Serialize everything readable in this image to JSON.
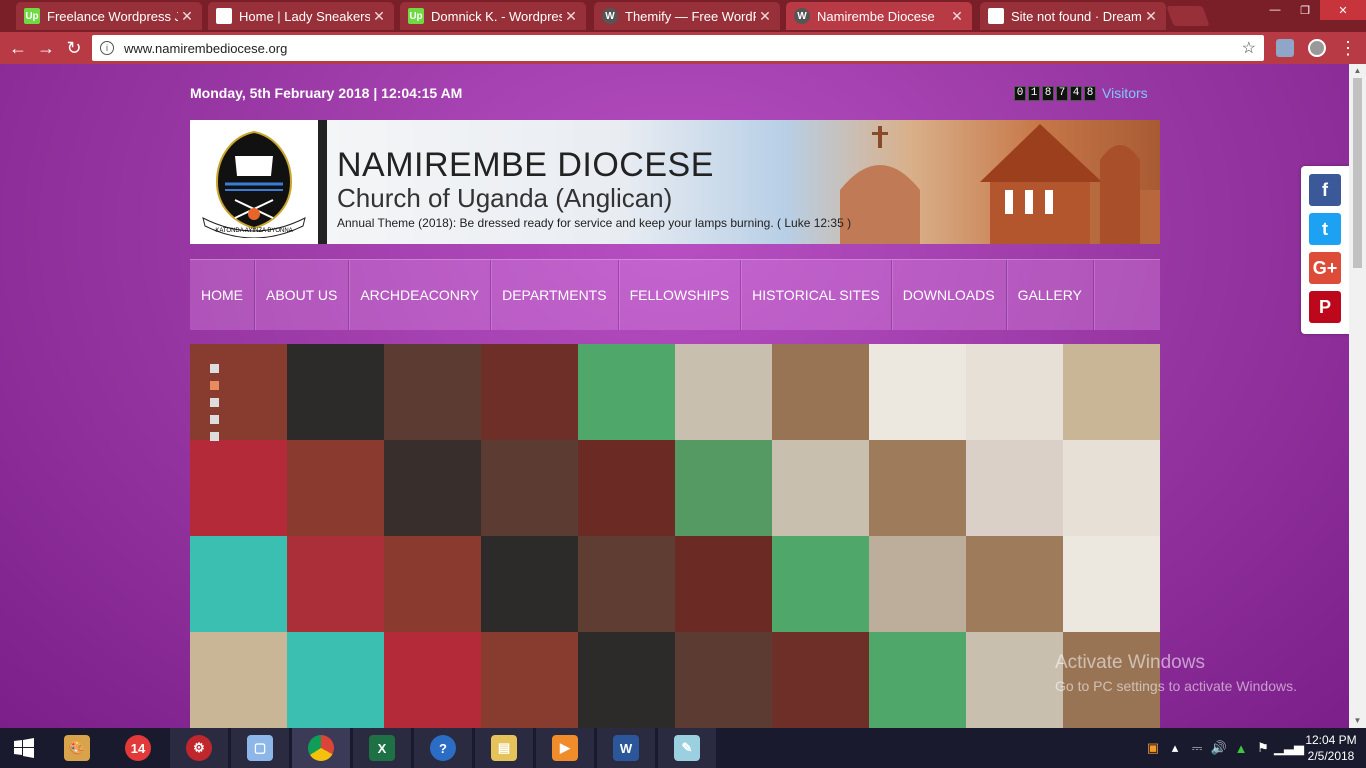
{
  "browser": {
    "tabs": [
      {
        "title": "Freelance Wordpress Jo",
        "favicon": "upwork-icon",
        "color": "#6fda44",
        "letter": "Up"
      },
      {
        "title": "Home | Lady Sneakers",
        "favicon": "page-icon",
        "color": "#ffffff",
        "letter": ""
      },
      {
        "title": "Domnick K. - Wordpress",
        "favicon": "upwork-icon",
        "color": "#6fda44",
        "letter": "Up"
      },
      {
        "title": "Themify — Free WordPre",
        "favicon": "wordpress-icon",
        "color": "#ffffff",
        "letter": "W"
      },
      {
        "title": "Namirembe Diocese",
        "favicon": "wordpress-icon",
        "color": "#ffffff",
        "letter": "W"
      },
      {
        "title": "Site not found · DreamH",
        "favicon": "document-icon",
        "color": "#ffffff",
        "letter": ""
      }
    ],
    "url": "www.namirembediocese.org"
  },
  "page": {
    "datetime": "Monday, 5th February 2018 | 12:04:15 AM",
    "counter_digits": [
      "0",
      "1",
      "8",
      "7",
      "4",
      "8"
    ],
    "visitors_label": "Visitors",
    "banner": {
      "title": "NAMIREMBE DIOCESE",
      "subtitle": "Church of Uganda (Anglican)",
      "theme": "Annual Theme (2018): Be dressed ready for service and keep your lamps burning. ( Luke 12:35 )",
      "seal_motto": "KATONDA AYINZA BYONNA"
    },
    "menu": [
      "HOME",
      "ABOUT US",
      "ARCHDEACONRY",
      "DEPARTMENTS",
      "FELLOWSHIPS",
      "HISTORICAL SITES",
      "DOWNLOADS",
      "GALLERY"
    ],
    "watermark": {
      "line1": "Activate Windows",
      "line2": "Go to PC settings to activate Windows."
    },
    "social": [
      {
        "name": "facebook-icon",
        "letter": "f",
        "color": "#3b5998"
      },
      {
        "name": "twitter-icon",
        "letter": "t",
        "color": "#1da1f2"
      },
      {
        "name": "google-plus-icon",
        "letter": "G+",
        "color": "#dd4b39"
      },
      {
        "name": "pinterest-icon",
        "letter": "P",
        "color": "#bd081c"
      }
    ]
  },
  "taskbar": {
    "time": "12:04 PM",
    "date": "2/5/2018"
  }
}
